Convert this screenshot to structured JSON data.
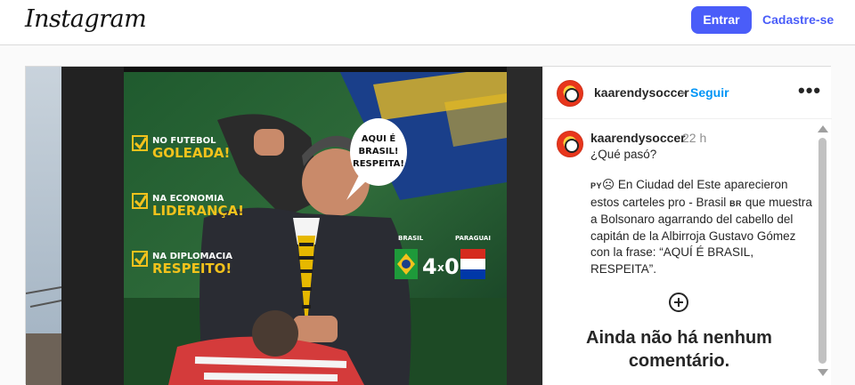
{
  "header": {
    "logo": "Instagram",
    "login_label": "Entrar",
    "signup_label": "Cadastre-se"
  },
  "post": {
    "image": {
      "description_icon": "billboard-image",
      "billboard_items": [
        {
          "top": "NO FUTEBOL",
          "bottom": "GOLEADA!"
        },
        {
          "top": "NA ECONOMIA",
          "bottom": "LIDERANÇA!"
        },
        {
          "top": "NA DIPLOMACIA",
          "bottom": "RESPEITO!"
        }
      ],
      "speech_bubble": [
        "AQUI É",
        "BRASIL!",
        "RESPEITA!"
      ],
      "score": {
        "team_left": "BRASIL",
        "team_right": "PARAGUAI",
        "left": "4",
        "x": "x",
        "right": "0"
      }
    },
    "owner": {
      "username": "kaarendysoccer",
      "separator": "•",
      "follow_label": "Seguir",
      "more_icon": "more-options-icon",
      "more_glyph": "•••"
    },
    "caption": {
      "username": "kaarendysoccer",
      "time": "22 h",
      "line1": "¿Qué pasó?",
      "flag_py": "PY",
      "flag_br": "BR",
      "text_a": " En Ciudad del Este aparecieron estos carteles pro - Brasil ",
      "text_b": " que muestra a Bolsonaro agarrando del cabello del capitán de la Albirroja Gustavo Gómez con la frase: “AQUÍ É BRASIL, RESPEITA”."
    },
    "no_comments": "Ainda não há nenhum comentário.",
    "add_icon": "add-circle-icon"
  },
  "colors": {
    "primary_button": "#4a5df9",
    "link": "#0095f6"
  }
}
